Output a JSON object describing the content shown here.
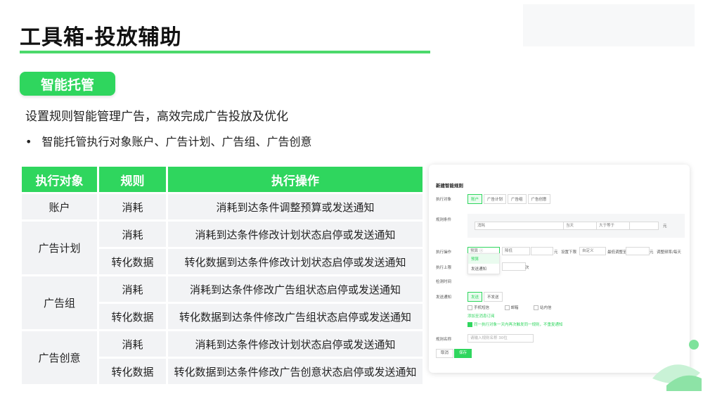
{
  "header": {
    "title": "工具箱-投放辅助"
  },
  "badge": {
    "label": "智能托管"
  },
  "subtitle": "设置规则智能管理广告，高效完成广告投放及优化",
  "bullet": {
    "marker": "•",
    "text": "智能托管执行对象账户、广告计划、广告组、广告创意"
  },
  "table": {
    "headers": [
      "执行对象",
      "规则",
      "执行操作"
    ],
    "groups": [
      {
        "object": "账户",
        "rows": [
          {
            "rule": "消耗",
            "action": "消耗到达条件调整预算或发送通知"
          }
        ]
      },
      {
        "object": "广告计划",
        "rows": [
          {
            "rule": "消耗",
            "action": "消耗到达条件修改计划状态启停或发送通知"
          },
          {
            "rule": "转化数据",
            "action": "转化数据到达条件修改计划状态启停或发送通知"
          }
        ]
      },
      {
        "object": "广告组",
        "rows": [
          {
            "rule": "消耗",
            "action": "消耗到达条件修改广告组状态启停或发送通知"
          },
          {
            "rule": "转化数据",
            "action": "转化数据到达条件修改广告组状态启停或发送通知"
          }
        ]
      },
      {
        "object": "广告创意",
        "rows": [
          {
            "rule": "消耗",
            "action": "消耗到达条件修改计划状态启停或发送通知"
          },
          {
            "rule": "转化数据",
            "action": "转化数据到达条件修改广告创意状态启停或发送通知"
          }
        ]
      }
    ]
  },
  "panel": {
    "title": "新建智能规则",
    "labels": {
      "target": "执行对象",
      "condition": "规则条件",
      "operation": "执行操作",
      "limit": "执行上限",
      "check_time": "检测时间",
      "notify": "发送通知",
      "name": "规则名称"
    },
    "target_options": [
      "账户",
      "广告计划",
      "广告组",
      "广告创意"
    ],
    "condition": {
      "metric": "消耗",
      "scope": "当天",
      "operator": "大于等于",
      "unit": "元"
    },
    "operation": {
      "select": "预算",
      "type": "降低",
      "unit": "元",
      "limit_label": "设置下限",
      "limit_value": "自定义",
      "floor_placeholder": "最低调整至",
      "floor_unit": "元",
      "tail": "调整频率/每天"
    },
    "dropdown": [
      "预算",
      "发送通知"
    ],
    "limit_unit": "次",
    "notify_options": [
      "发送",
      "不发送"
    ],
    "notify_channels": [
      "手机短信",
      "邮箱",
      "站内信"
    ],
    "notify_link": "添加至消息订阅",
    "sync_note": "同一执行对象一天内再次触发同一规则，不重复通知",
    "name_placeholder": "请输入规则名称 30位",
    "buttons": {
      "cancel": "取消",
      "save": "保存"
    }
  },
  "colors": {
    "accent": "#2fd65e",
    "title_line": "#4cd96b"
  }
}
